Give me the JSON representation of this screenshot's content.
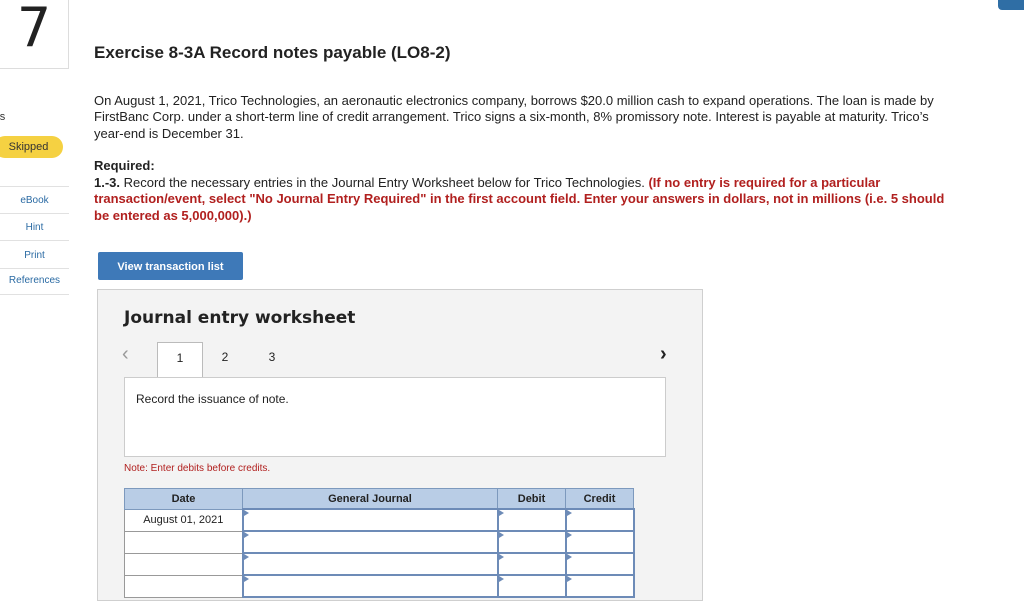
{
  "question": {
    "number": "7",
    "points_label": "oints",
    "status_badge": "Skipped"
  },
  "sidebar": {
    "links": [
      "eBook",
      "Hint",
      "Print",
      "References"
    ]
  },
  "exercise": {
    "title": "Exercise 8-3A Record notes payable (LO8-2)",
    "body": "On August 1, 2021, Trico Technologies, an aeronautic electronics company, borrows $20.0 million cash to expand operations. The loan is made by FirstBanc Corp. under a short-term line of credit arrangement. Trico signs a six-month, 8% promissory note. Interest is payable at maturity. Trico’s year-end is December 31.",
    "required_label": "Required:",
    "required_num": "1.-3.",
    "required_text": " Record the necessary entries in the Journal Entry Worksheet below for Trico Technologies. ",
    "required_instructions": "(If no entry is required for a particular transaction/event, select \"No Journal Entry Required\" in the first account field. Enter your answers in dollars, not in millions (i.e. 5 should be entered as 5,000,000).)"
  },
  "button": {
    "view_transactions": "View transaction list"
  },
  "worksheet": {
    "title": "Journal entry worksheet",
    "tabs": [
      "1",
      "2",
      "3"
    ],
    "active_tab": "1",
    "description": "Record the issuance of note.",
    "note": "Note: Enter debits before credits.",
    "columns": {
      "date": "Date",
      "journal": "General Journal",
      "debit": "Debit",
      "credit": "Credit"
    },
    "rows": [
      {
        "date": "August 01, 2021"
      },
      {
        "date": ""
      },
      {
        "date": ""
      },
      {
        "date": ""
      }
    ]
  }
}
